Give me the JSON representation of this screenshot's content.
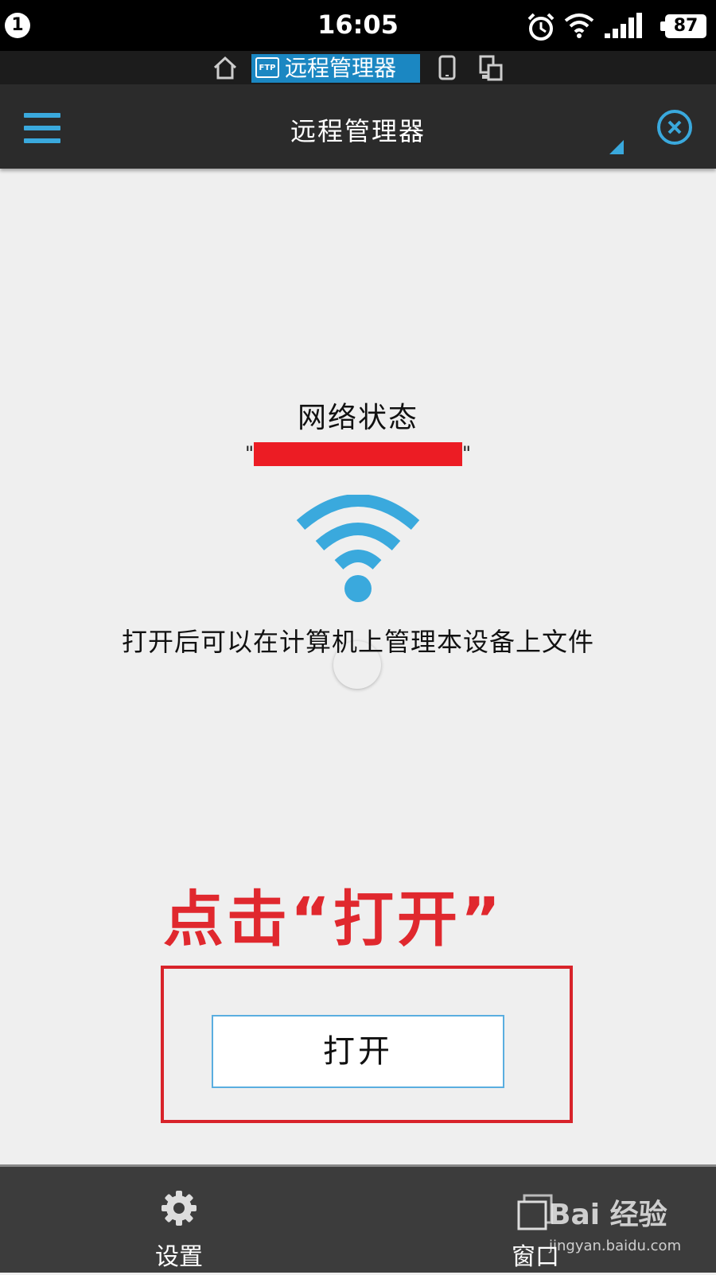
{
  "status_bar": {
    "notification_count": "1",
    "time": "16:05",
    "battery": "87",
    "icons": [
      "alarm-icon",
      "wifi-icon",
      "signal-icon",
      "battery-icon"
    ]
  },
  "tab_strip": {
    "active_tab_label": "远程管理器",
    "active_tab_icon": "ftp-icon",
    "other_icons": [
      "home-icon",
      "phone-icon",
      "devices-icon"
    ]
  },
  "header": {
    "title": "远程管理器",
    "menu_icon": "hamburger-icon",
    "close_icon": "close-circle-icon",
    "accent_color": "#3aa9dd"
  },
  "main": {
    "network_status_label": "网络状态",
    "ssid_open_quote": "\"",
    "ssid_value": "",
    "ssid_close_quote": "\"",
    "wifi_icon": "wifi-icon",
    "description": "打开后可以在计算机上管理本设备上文件",
    "annotation": "点击“打开”",
    "open_button_label": "打开"
  },
  "bottom_bar": {
    "settings_label": "设置",
    "settings_icon": "gear-icon",
    "window_label": "窗口",
    "window_icon": "windows-icon"
  },
  "watermark": {
    "text": "Bai 经验",
    "url": "jingyan.baidu.com"
  }
}
